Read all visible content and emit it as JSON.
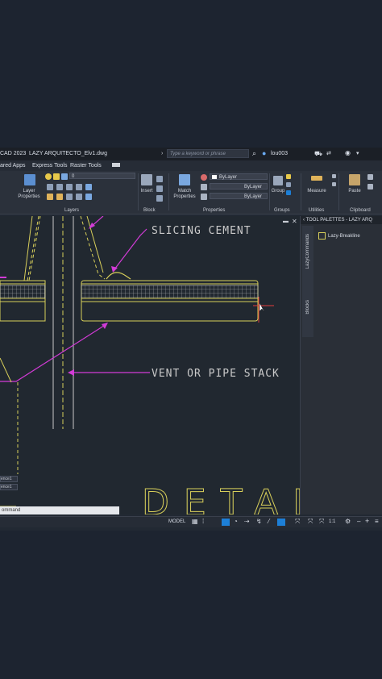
{
  "titlebar": {
    "app_name": "CAD 2023",
    "file_name": "LAZY ARQUITECTO_Elv1.dwg",
    "search_placeholder": "Type a keyword or phrase",
    "user": "lou003"
  },
  "ribbon_tabs": [
    "ared Apps",
    "Express Tools",
    "Raster Tools"
  ],
  "ribbon": {
    "layer_properties": "Layer\nProperties",
    "layer_value": "0",
    "layers_label": "Layers",
    "insert": "Insert",
    "block_label": "Block",
    "match_properties": "Match\nProperties",
    "color_value": "ByLayer",
    "linetype_value": "ByLayer",
    "lineweight_value": "ByLayer",
    "properties_label": "Properties",
    "group": "Group",
    "groups_label": "Groups",
    "measure": "Measure",
    "utilities_label": "Utilities",
    "paste": "Paste",
    "clipboard_label": "Clipboard"
  },
  "drawing": {
    "label_1": "SLICING CEMENT",
    "label_2": "VENT OR PIPE STACK",
    "watermark": "DETAI"
  },
  "palette": {
    "title": "TOOL PALETTES - LAZY ARQ",
    "item": "Lazy-Breakline",
    "tab_1": "LazyCommands",
    "tab_2": "Blocks"
  },
  "command": {
    "history_1": "ence1",
    "history_2": "ence1",
    "input": "ommand"
  },
  "statusbar": {
    "model": "MODEL",
    "scale": "1:1"
  },
  "colors": {
    "accent_blue": "#1d7fd6",
    "cad_yellow": "#d8cf5a",
    "cad_magenta": "#d23bd6",
    "cad_red": "#e23c3c"
  }
}
